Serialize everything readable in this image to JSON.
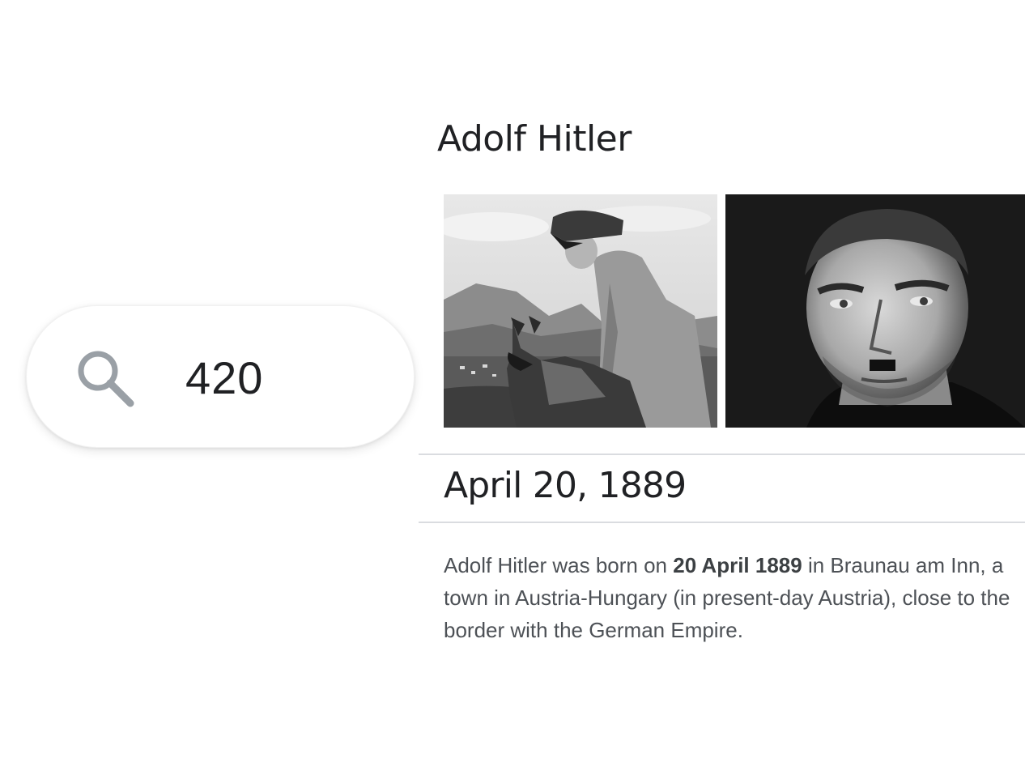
{
  "search": {
    "query": "420"
  },
  "knowledge_panel": {
    "title": "Adolf Hitler",
    "answer": "April 20, 1889",
    "snippet": {
      "before": "Adolf Hitler was born on ",
      "highlight": "20 April 1889",
      "after": " in Braunau am Inn, a town in Austria-Hungary (in present-day Austria), close to the border with the German Empire."
    }
  },
  "icons": {
    "search": "search-icon"
  },
  "colors": {
    "icon_gray": "#9aa0a6",
    "text_primary": "#202124",
    "text_secondary": "#4d5156",
    "divider": "#dadce0"
  }
}
